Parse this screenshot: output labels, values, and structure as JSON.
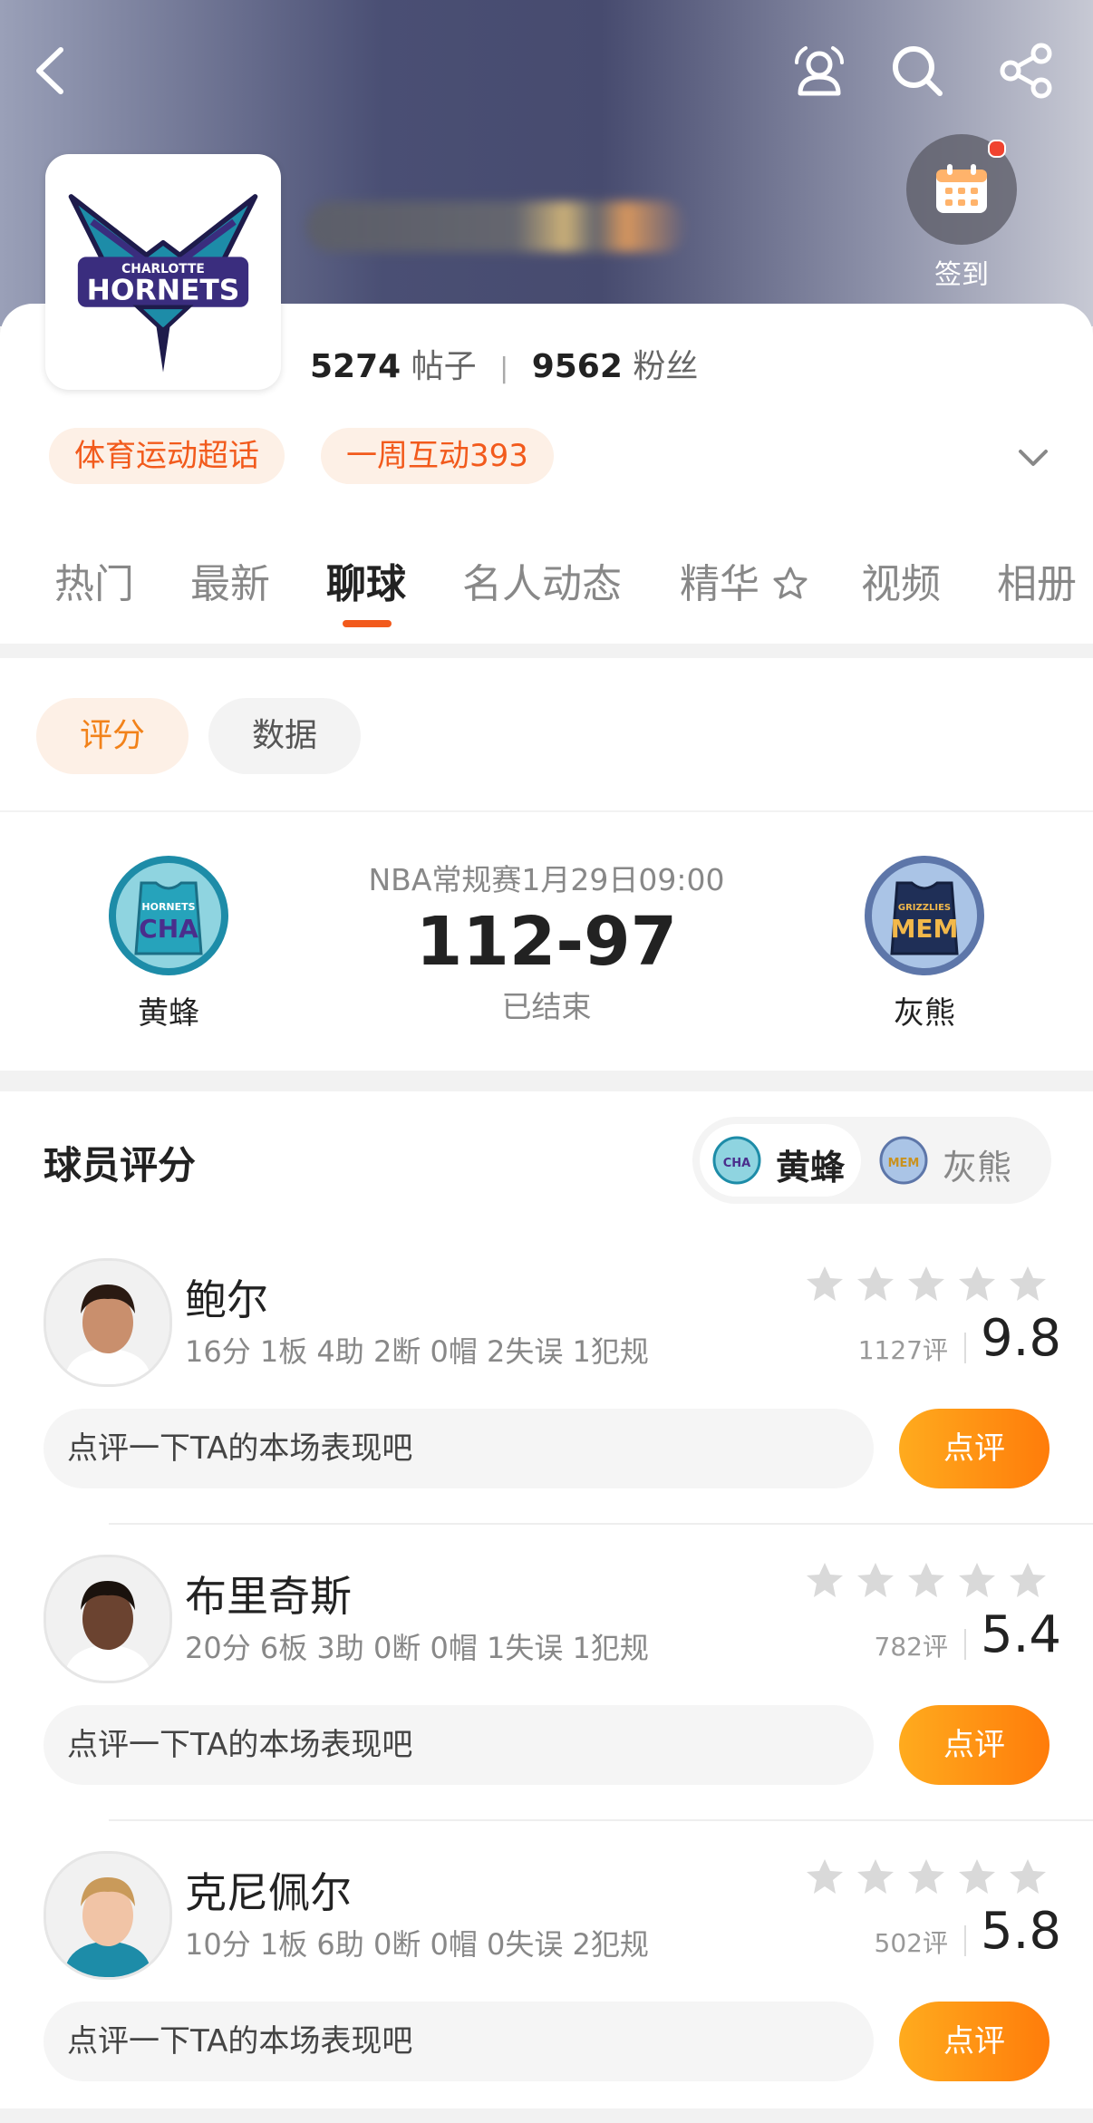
{
  "header": {
    "checkin_label": "签到"
  },
  "profile": {
    "logo_text_top": "CHARLOTTE",
    "logo_text_main": "HORNETS",
    "posts_count": "5274",
    "posts_label": "帖子",
    "fans_count": "9562",
    "fans_label": "粉丝",
    "tags": [
      "体育运动超话",
      "一周互动393"
    ]
  },
  "tabs": [
    "热门",
    "最新",
    "聊球",
    "名人动态",
    "精华",
    "视频",
    "相册"
  ],
  "active_tab": "聊球",
  "subtabs": {
    "rating": "评分",
    "data": "数据"
  },
  "game": {
    "info": "NBA常规赛1月29日09:00",
    "score": "112-97",
    "status": "已结束",
    "home": {
      "name": "黄蜂",
      "badge_top": "HORNETS",
      "badge_main": "CHA",
      "color": "#1d8ca8"
    },
    "away": {
      "name": "灰熊",
      "badge_top": "GRIZZLIES",
      "badge_main": "MEM",
      "color": "#5d76a9"
    }
  },
  "player_ratings": {
    "title": "球员评分",
    "team_switch": [
      "黄蜂",
      "灰熊"
    ]
  },
  "players": [
    {
      "name": "鲍尔",
      "stats": "16分 1板 4助 2断 0帽 2失误 1犯规",
      "count": "1127评",
      "rating": "9.8",
      "comment_placeholder": "点评一下TA的本场表现吧",
      "button": "点评"
    },
    {
      "name": "布里奇斯",
      "stats": "20分 6板 3助 0断 0帽 1失误 1犯规",
      "count": "782评",
      "rating": "5.4",
      "comment_placeholder": "点评一下TA的本场表现吧",
      "button": "点评"
    },
    {
      "name": "克尼佩尔",
      "stats": "10分 1板 6助 0断 0帽 0失误 2犯规",
      "count": "502评",
      "rating": "5.8",
      "comment_placeholder": "点评一下TA的本场表现吧",
      "button": "点评"
    }
  ],
  "colors": {
    "accent": "#f25a1c",
    "button_orange": "#ff8a10",
    "hornets_teal": "#1d8ca8",
    "hornets_purple": "#3a2d7e"
  }
}
